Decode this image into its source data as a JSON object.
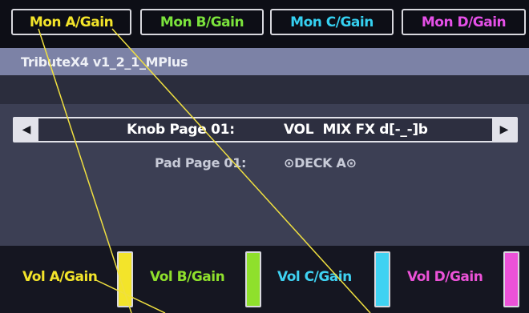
{
  "monitor_buttons": [
    {
      "label": "Mon A/Gain",
      "color": "#f3e42a"
    },
    {
      "label": "Mon B/Gain",
      "color": "#7be33c"
    },
    {
      "label": "Mon C/Gain",
      "color": "#35d0f0"
    },
    {
      "label": "Mon D/Gain",
      "color": "#e650e8"
    }
  ],
  "status": {
    "title": "TributeX4 v1_2_1_MPlus"
  },
  "knob_page": {
    "label": "Knob Page 01:",
    "value": "VOL  MIX FX d[-_-]b",
    "prev_icon": "left-triangle-icon",
    "next_icon": "right-triangle-icon"
  },
  "pad_page": {
    "label": "Pad Page 01:",
    "value": "⊙DECK A⊙"
  },
  "volume_controls": [
    {
      "label": "Vol A/Gain",
      "color": "#f3e42a",
      "level": 1.0
    },
    {
      "label": "Vol B/Gain",
      "color": "#8fe02c",
      "level": 1.0
    },
    {
      "label": "Vol C/Gain",
      "color": "#3fd2f2",
      "level": 1.0
    },
    {
      "label": "Vol D/Gain",
      "color": "#ec52d8",
      "level": 1.0
    }
  ]
}
